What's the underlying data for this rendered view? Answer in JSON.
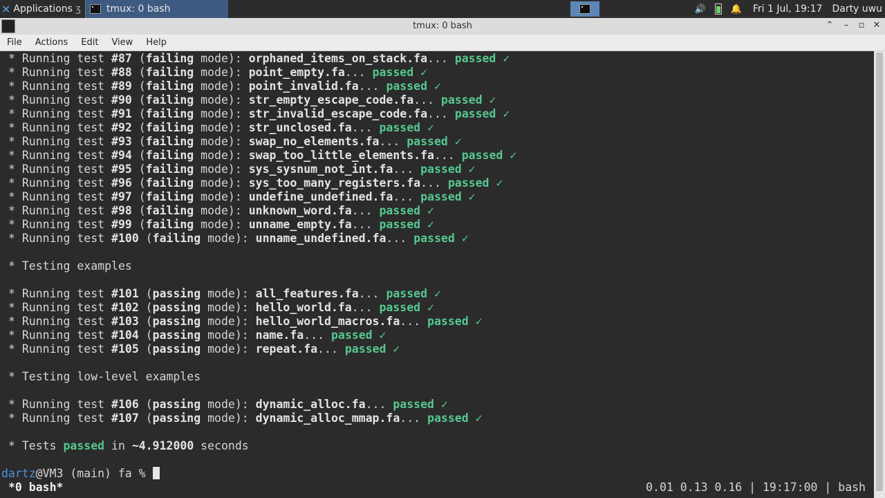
{
  "panel": {
    "applications_label": "Applications",
    "task_title": "tmux: 0 bash",
    "clock": "Fri  1 Jul, 19:17",
    "user": "Darty uwu"
  },
  "window": {
    "title": "tmux: 0 bash"
  },
  "menu": [
    "File",
    "Actions",
    "Edit",
    "View",
    "Help"
  ],
  "terminal": {
    "failing_tests": [
      {
        "num": "#87",
        "file": "orphaned_items_on_stack.fa"
      },
      {
        "num": "#88",
        "file": "point_empty.fa"
      },
      {
        "num": "#89",
        "file": "point_invalid.fa"
      },
      {
        "num": "#90",
        "file": "str_empty_escape_code.fa"
      },
      {
        "num": "#91",
        "file": "str_invalid_escape_code.fa"
      },
      {
        "num": "#92",
        "file": "str_unclosed.fa"
      },
      {
        "num": "#93",
        "file": "swap_no_elements.fa"
      },
      {
        "num": "#94",
        "file": "swap_too_little_elements.fa"
      },
      {
        "num": "#95",
        "file": "sys_sysnum_not_int.fa"
      },
      {
        "num": "#96",
        "file": "sys_too_many_registers.fa"
      },
      {
        "num": "#97",
        "file": "undefine_undefined.fa"
      },
      {
        "num": "#98",
        "file": "unknown_word.fa"
      },
      {
        "num": "#99",
        "file": "unname_empty.fa"
      },
      {
        "num": "#100",
        "file": "unname_undefined.fa"
      }
    ],
    "examples_header": "* Testing examples",
    "example_tests": [
      {
        "num": "#101",
        "file": "all_features.fa"
      },
      {
        "num": "#102",
        "file": "hello_world.fa"
      },
      {
        "num": "#103",
        "file": "hello_world_macros.fa"
      },
      {
        "num": "#104",
        "file": "name.fa"
      },
      {
        "num": "#105",
        "file": "repeat.fa"
      }
    ],
    "lowlevel_header": "* Testing low-level examples",
    "lowlevel_tests": [
      {
        "num": "#106",
        "file": "dynamic_alloc.fa"
      },
      {
        "num": "#107",
        "file": "dynamic_alloc_mmap.fa"
      }
    ],
    "failing_mode": "failing",
    "passing_mode": "passing",
    "passed_word": "passed",
    "check": "✓",
    "summary_prefix": "* Tests",
    "summary_passed": "passed",
    "summary_in": "in",
    "summary_time": "~4.912000",
    "summary_suffix": "seconds",
    "prompt_user": "dartz",
    "prompt_rest": "@VM3 (main) fa % "
  },
  "tmux_status": {
    "left": "*0 bash*",
    "right": "0.01 0.13 0.16 | 19:17:00 | bash"
  },
  "colors": {
    "passed": "#55c890",
    "prompt_user": "#4f8fd8",
    "terminal_bg": "#2b2b2b"
  }
}
